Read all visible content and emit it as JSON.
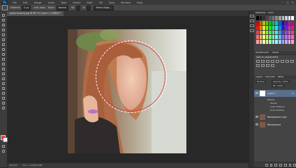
{
  "app": {
    "logo": "Ps"
  },
  "menu": [
    "File",
    "Edit",
    "Image",
    "Layer",
    "Type",
    "Select",
    "Filter",
    "3D",
    "View",
    "Window",
    "Help"
  ],
  "window_controls": [
    "–",
    "□",
    "✕"
  ],
  "options": {
    "feather": {
      "label": "Feather:",
      "value": "0 px"
    },
    "antialias": {
      "label": "Anti-alias"
    },
    "style": {
      "label": "Style:",
      "value": "Normal"
    },
    "width": {
      "label": "W:",
      "value": ""
    },
    "height": {
      "label": "H:",
      "value": ""
    },
    "refine": "Refine Edge..."
  },
  "document_tab": "glady-fanging.jpg @ 66.7% (Layer 1, RGB/8) *",
  "status": {
    "zoom": "66.67%",
    "doc": "Doc: 1.27M/4.53M"
  },
  "panels": {
    "swatches_tab": "Swatches",
    "color_tab": "Color",
    "adjustments_tab": "Adjustments",
    "styles_tab": "Styles",
    "adjustments_title": "Add an adjustment",
    "layers_tab": "Layers",
    "channels_tab": "Channels",
    "paths_tab": "Paths",
    "blend_mode": "Normal",
    "opacity": "Opacity: 100%",
    "fill": "Fill: 100%"
  },
  "layers": [
    {
      "name": "Layer 1",
      "fx": "fx",
      "selected": true
    },
    {
      "name": "Background copy",
      "fx": "",
      "selected": false
    },
    {
      "name": "Background",
      "fx": "",
      "selected": false
    }
  ],
  "effects": [
    "Effects",
    "Stroke",
    "Inner Shadow",
    "Drop Shadow"
  ],
  "colors": {
    "accent": "#31a8ff",
    "selection": "#dc3c3c",
    "layer_selected": "#5a6f8a"
  }
}
